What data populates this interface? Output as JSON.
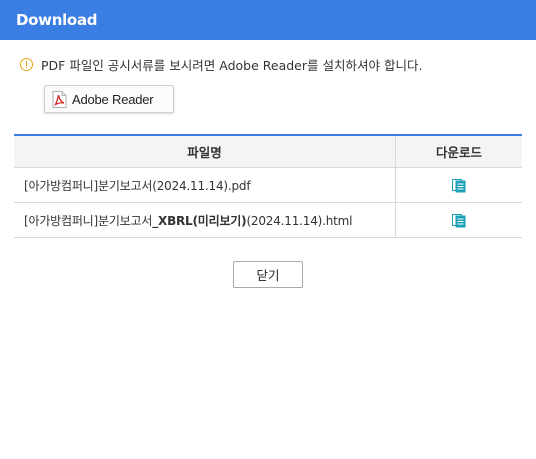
{
  "window": {
    "title": "Download"
  },
  "notice": {
    "text": "PDF 파일인 공시서류를 보시려면 Adobe Reader를 설치하셔야 합니다.",
    "icon": "warning-circle-icon",
    "icon_color": "#e3a40c"
  },
  "adobe_button": {
    "label": "Adobe Reader",
    "icon": "pdf-icon"
  },
  "table": {
    "headers": {
      "filename": "파일명",
      "download": "다운로드"
    },
    "rows": [
      {
        "name_prefix": "[아가방컴퍼니]분기보고서",
        "name_strong": "",
        "name_suffix": "(2024.11.14).pdf",
        "download_icon": "document-download-icon"
      },
      {
        "name_prefix": "[아가방컴퍼니]분기보고서",
        "name_strong": "_XBRL(미리보기)",
        "name_suffix": "(2024.11.14).html",
        "download_icon": "document-download-icon"
      }
    ]
  },
  "close_button": {
    "label": "닫기"
  },
  "colors": {
    "accent": "#3a7de3",
    "header_bg": "#f4f4f4",
    "border": "#d9d9d9",
    "icon_teal": "#1ba0b5"
  }
}
